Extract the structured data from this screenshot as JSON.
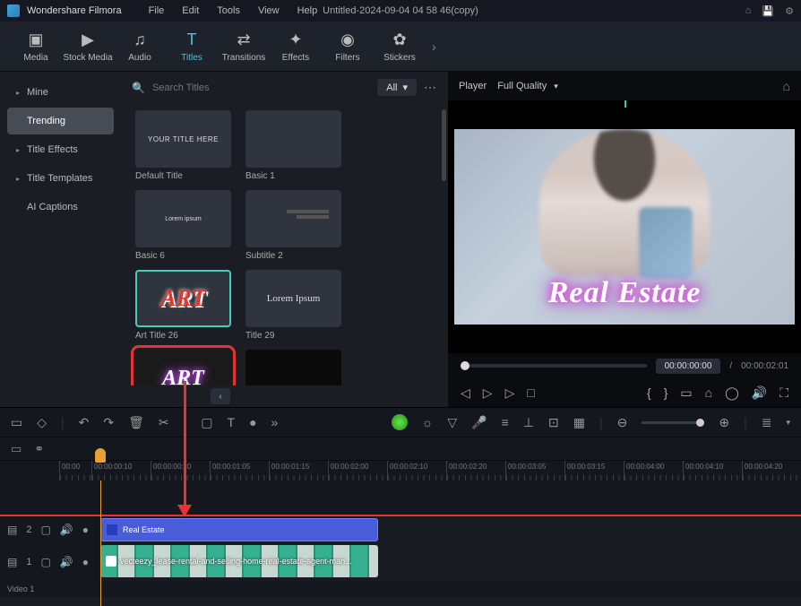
{
  "app": {
    "name": "Wondershare Filmora"
  },
  "menu": [
    "File",
    "Edit",
    "Tools",
    "View",
    "Help"
  ],
  "document_title": "Untitled-2024-09-04 04 58 46(copy)",
  "toolbar": [
    {
      "label": "Media",
      "icon": "▣"
    },
    {
      "label": "Stock Media",
      "icon": "▶"
    },
    {
      "label": "Audio",
      "icon": "♫"
    },
    {
      "label": "Titles",
      "icon": "T",
      "active": true
    },
    {
      "label": "Transitions",
      "icon": "⇄"
    },
    {
      "label": "Effects",
      "icon": "✦"
    },
    {
      "label": "Filters",
      "icon": "⚙"
    },
    {
      "label": "Stickers",
      "icon": "✿"
    }
  ],
  "sidebar": [
    {
      "label": "Mine",
      "chev": true
    },
    {
      "label": "Trending",
      "active": true,
      "indent": true
    },
    {
      "label": "Title Effects",
      "chev": true
    },
    {
      "label": "Title Templates",
      "chev": true
    },
    {
      "label": "AI Captions",
      "indent": true
    }
  ],
  "search": {
    "placeholder": "Search Titles"
  },
  "filter": {
    "label": "All"
  },
  "titles_grid": [
    {
      "label": "Default Title",
      "text": "YOUR TITLE HERE",
      "style": "default"
    },
    {
      "label": "Basic 1",
      "text": "",
      "style": "empty"
    },
    {
      "label": "Basic 6",
      "text": "Lorem ipsum",
      "style": "small"
    },
    {
      "label": "Subtitle 2",
      "text": "",
      "style": "subtitle"
    },
    {
      "label": "Art Title 26",
      "text": "ART",
      "style": "art-red",
      "selected": true
    },
    {
      "label": "Title 29",
      "text": "Lorem Ipsum",
      "style": "lorem"
    },
    {
      "label": "",
      "text": "ART",
      "style": "art-neon",
      "highlighted": true
    },
    {
      "label": "",
      "text": "",
      "style": "dark-strip"
    }
  ],
  "preview": {
    "player_label": "Player",
    "quality": "Full Quality",
    "overlay_text": "Real Estate",
    "time_current": "00:00:00:00",
    "time_sep": "/",
    "time_total": "00:00:02:01"
  },
  "ruler_ticks": [
    "00:00",
    "00:00:00:10",
    "00:00:00:20",
    "00:00:01:05",
    "00:00:01:15",
    "00:00:02:00",
    "00:00:02:10",
    "00:00:02:20",
    "00:00:03:05",
    "00:00:03:15",
    "00:00:04:00",
    "00:00:04:10",
    "00:00:04:20"
  ],
  "tracks": {
    "t2": {
      "num": "2",
      "clip_label": "Real Estate"
    },
    "t1": {
      "num": "1",
      "clip_label": "vecteezy_lease-rental-and-selling-home-real-estate-agent-man..."
    },
    "video_label": "Video 1"
  }
}
